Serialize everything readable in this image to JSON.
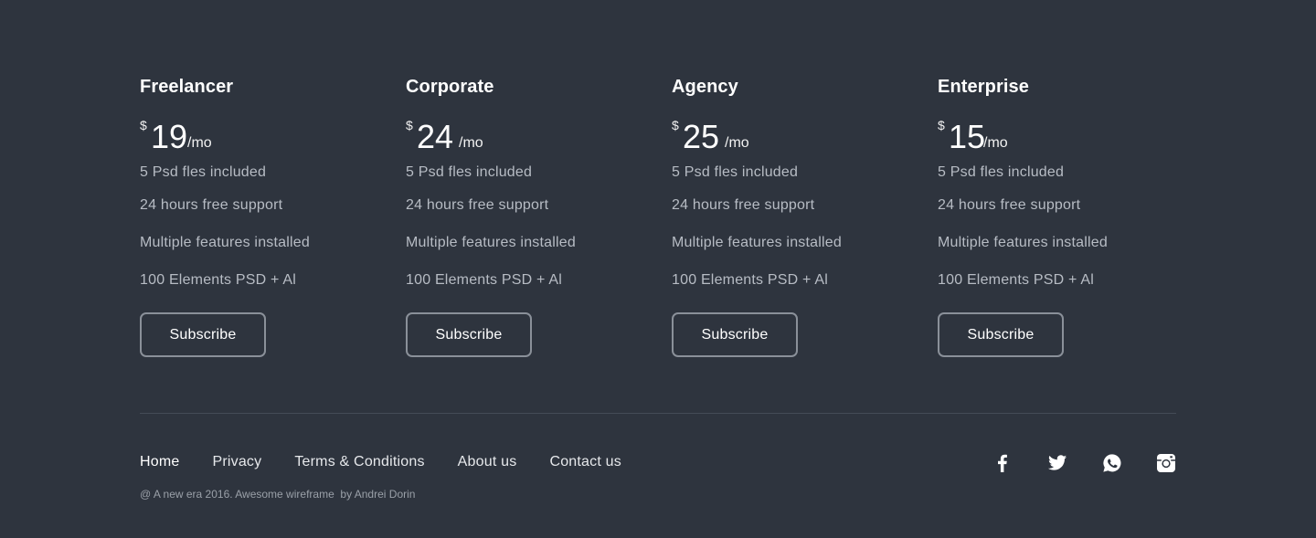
{
  "plans": [
    {
      "name": "Freelancer",
      "currency": "$",
      "price": "19",
      "period": "/mo",
      "features": [
        "5 Psd fles included",
        "24 hours free support",
        "Multiple features installed",
        "100 Elements PSD + Al"
      ],
      "button": "Subscribe"
    },
    {
      "name": "Corporate",
      "currency": "$",
      "price": "24",
      "period": "/mo",
      "features": [
        "5 Psd fles included",
        "24 hours free support",
        "Multiple features installed",
        "100 Elements PSD + Al"
      ],
      "button": "Subscribe"
    },
    {
      "name": "Agency",
      "currency": "$",
      "price": "25",
      "period": "/mo",
      "features": [
        "5 Psd fles included",
        "24 hours free support",
        "Multiple features installed",
        "100 Elements PSD + Al"
      ],
      "button": "Subscribe"
    },
    {
      "name": "Enterprise",
      "currency": "$",
      "price": "15",
      "period": "/mo",
      "features": [
        "5 Psd fles included",
        "24 hours free support",
        "Multiple features installed",
        "100 Elements PSD + Al"
      ],
      "button": "Subscribe"
    }
  ],
  "footer": {
    "nav": [
      "Home",
      "Privacy",
      "Terms & Conditions",
      "About us",
      "Contact us"
    ],
    "copyright": "@ A new era 2016. Awesome wireframe  by Andrei Dorin",
    "social": [
      "facebook-icon",
      "twitter-icon",
      "whatsapp-icon",
      "instagram-icon"
    ]
  },
  "colors": {
    "background": "#2e343e",
    "text": "#ffffff",
    "muted_text": "#b7bcc4",
    "button_border": "#8a9099",
    "divider": "#454c57"
  }
}
